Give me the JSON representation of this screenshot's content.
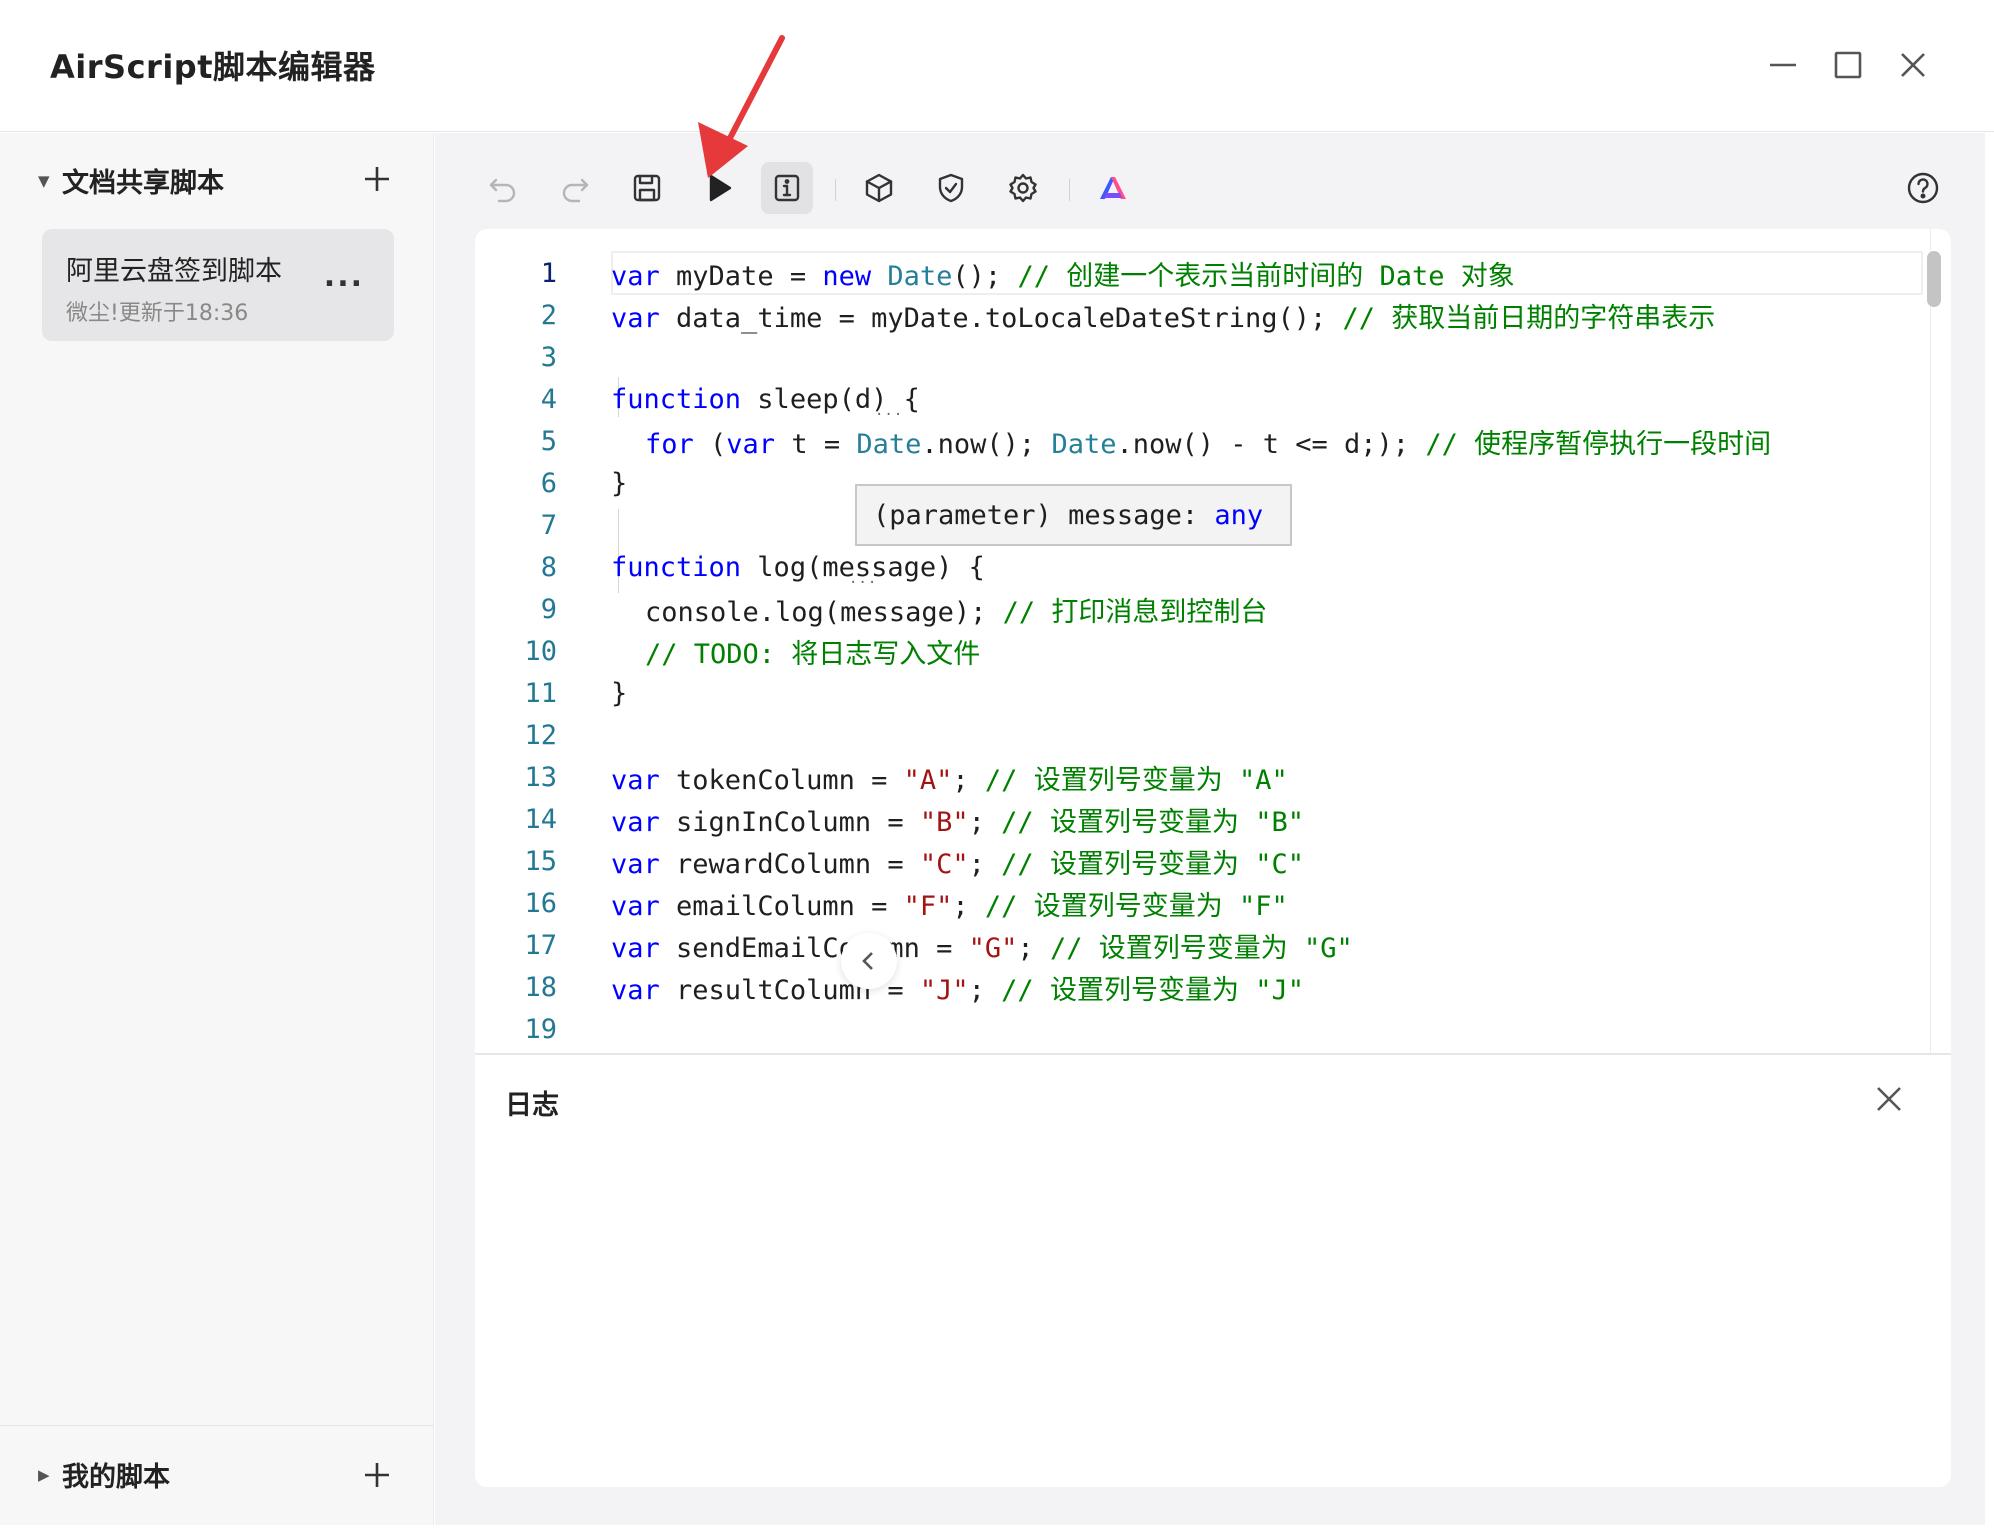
{
  "window": {
    "title": "AirScript脚本编辑器"
  },
  "sidebar": {
    "shared_section": "文档共享脚本",
    "scripts": [
      {
        "title": "阿里云盘签到脚本",
        "subtitle": "微尘!更新于18:36",
        "more": "..."
      }
    ],
    "my_section": "我的脚本"
  },
  "toolbar": {
    "buttons": [
      "undo-icon",
      "redo-icon",
      "save-icon",
      "run-icon",
      "info-icon",
      "package-icon",
      "shield-icon",
      "gear-icon",
      "brand-logo-icon",
      "help-icon"
    ]
  },
  "editor": {
    "line_numbers": [
      "1",
      "2",
      "3",
      "4",
      "5",
      "6",
      "7",
      "8",
      "9",
      "10",
      "11",
      "12",
      "13",
      "14",
      "15",
      "16",
      "17",
      "18",
      "19"
    ],
    "tooltip": {
      "param": "(parameter) message: ",
      "type": "any"
    },
    "tokens": {
      "var": "var",
      "function": "function",
      "for": "for",
      "new": "new",
      "Date": "Date",
      "l1_a": " myDate = ",
      "l1_b": "(); ",
      "l1_comment": "// 创建一个表示当前时间的 Date 对象",
      "l2_a": " data_time = myDate.toLocaleDateString(); ",
      "l2_comment": "// 获取当前日期的字符串表示",
      "l4_a": " sleep(d) {",
      "l5_a": " (",
      "l5_b": " t = ",
      "l5_c": ".now(); ",
      "l5_d": ".now() - t <= d;); ",
      "l5_comment": "// 使程序暂停执行一段时间",
      "l6": "}",
      "l8_a": " log(message) {",
      "l9_a": "console.log(message); ",
      "l9_comment": "// 打印消息到控制台",
      "l10_comment": "// TODO: 将日志写入文件",
      "l11": "}",
      "l13_a": " tokenColumn = ",
      "l13_str": "\"A\"",
      "l13_comment": "// 设置列号变量为 \"A\"",
      "l14_a": " signInColumn = ",
      "l14_str": "\"B\"",
      "l14_comment": "// 设置列号变量为 \"B\"",
      "l15_a": " rewardColumn = ",
      "l15_str": "\"C\"",
      "l15_comment": "// 设置列号变量为 \"C\"",
      "l16_a": " emailColumn = ",
      "l16_str": "\"F\"",
      "l16_comment": "// 设置列号变量为 \"F\"",
      "l17_a": " sendEmailColumn = ",
      "l17_str": "\"G\"",
      "l17_comment": "// 设置列号变量为 \"G\"",
      "l18_a": " resultColumn = ",
      "l18_str": "\"J\"",
      "l18_comment": "// 设置列号变量为 \"J\"",
      "semi": "; "
    }
  },
  "log_panel": {
    "title": "日志"
  },
  "colors": {
    "keyword": "#0000ff",
    "type": "#267f99",
    "comment": "#008000",
    "string": "#a31515",
    "arrow": "#e5393b"
  }
}
